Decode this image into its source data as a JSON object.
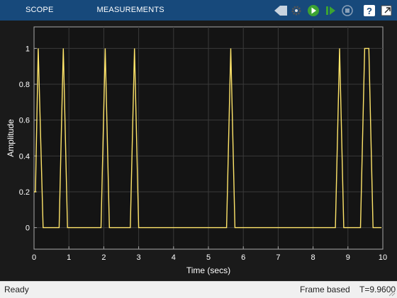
{
  "toolbar": {
    "tabs": [
      {
        "label": "SCOPE"
      },
      {
        "label": "MEASUREMENTS"
      }
    ],
    "icons": [
      "collapse-toolstrip-icon",
      "settings-gear-icon",
      "run-icon",
      "step-forward-icon",
      "stop-icon",
      "help-icon",
      "undock-icon"
    ],
    "colors": {
      "bar": "#17497b",
      "run": "#3ca332",
      "trace": "#ffe56a",
      "background": "#141414"
    }
  },
  "chart_data": {
    "type": "line",
    "title": "",
    "xlabel": "Time (secs)",
    "ylabel": "Amplitude",
    "xlim": [
      0,
      10
    ],
    "ylim": [
      -0.12,
      1.12
    ],
    "xticks": [
      "0",
      "1",
      "2",
      "3",
      "4",
      "5",
      "6",
      "7",
      "8",
      "9",
      "10"
    ],
    "yticks": [
      "0",
      "0.2",
      "0.4",
      "0.6",
      "0.8",
      "1"
    ],
    "grid": true,
    "series": [
      {
        "x": [
          0,
          0.04,
          0.12,
          0.26,
          0.72,
          0.84,
          0.96,
          1.92,
          2.04,
          2.16,
          2.76,
          2.88,
          3.0,
          5.52,
          5.64,
          5.76,
          8.64,
          8.76,
          8.88,
          9.36,
          9.48,
          9.6,
          9.72,
          9.96
        ],
        "y": [
          0.2,
          0.2,
          1.0,
          0.0,
          0.0,
          1.0,
          0.0,
          0.0,
          1.0,
          0.0,
          0.0,
          1.0,
          0.0,
          0.0,
          1.0,
          0.0,
          0.0,
          1.0,
          0.0,
          0.0,
          1.0,
          1.0,
          0.0,
          0.0
        ]
      }
    ]
  },
  "status": {
    "state": "Ready",
    "mode": "Frame based",
    "time": "T=9.9600"
  }
}
